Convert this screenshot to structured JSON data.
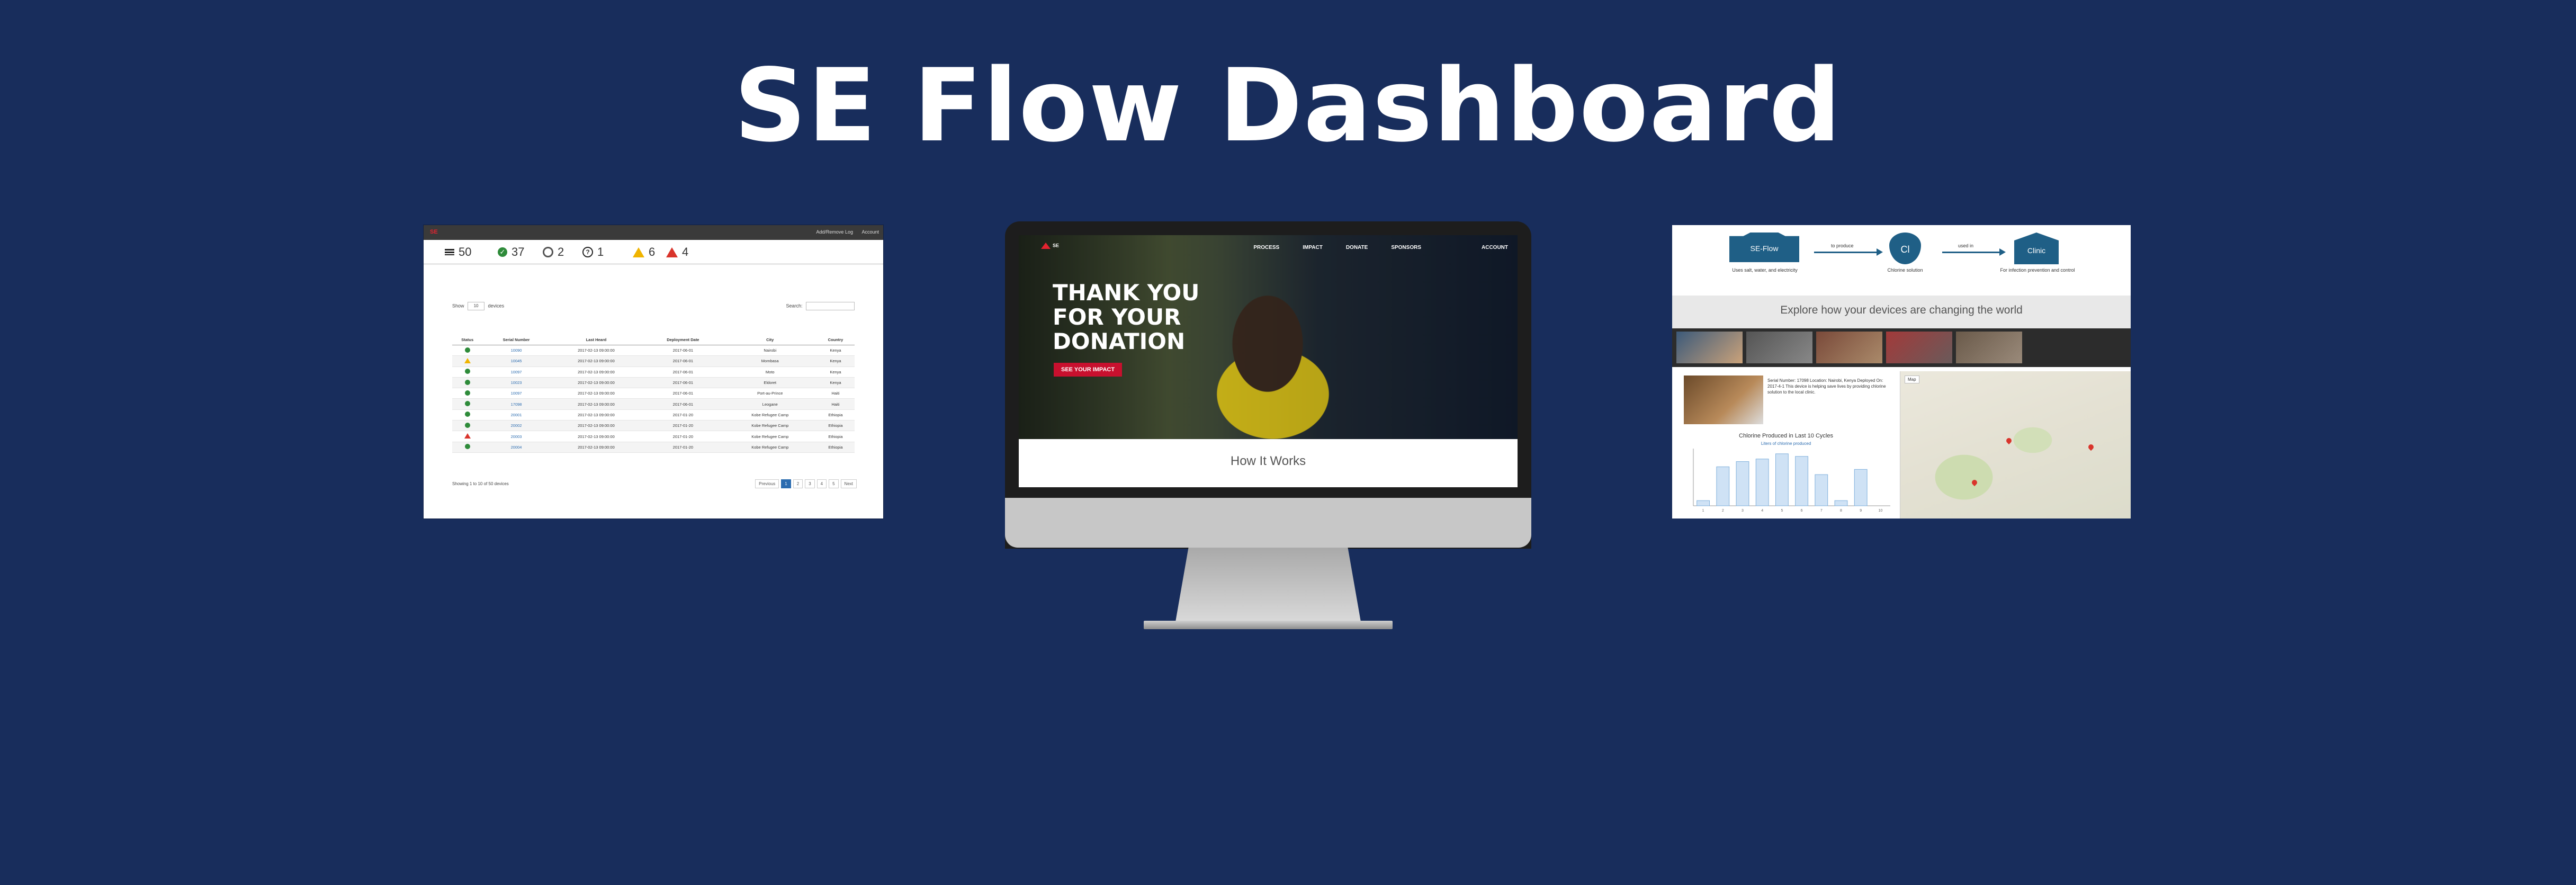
{
  "page": {
    "title": "SE Flow Dashboard",
    "background": "#182d5c"
  },
  "dashboard": {
    "logo": "SE",
    "nav": [
      "Add/Remove Log",
      "Account"
    ],
    "stats": [
      {
        "icon": "list-icon",
        "value": "50"
      },
      {
        "icon": "check-circle-icon",
        "value": "37"
      },
      {
        "icon": "ring-icon",
        "value": "2"
      },
      {
        "icon": "question-icon",
        "value": "1"
      },
      {
        "icon": "warning-icon",
        "value": "6"
      },
      {
        "icon": "error-icon",
        "value": "4"
      }
    ],
    "show_label": "Show",
    "show_value": "10",
    "entries_label": "devices",
    "search_label": "Search:",
    "columns": [
      "Status",
      "Serial Number",
      "Last Heard",
      "Deployment Date",
      "City",
      "Country"
    ],
    "rows": [
      {
        "status": "ok",
        "serial": "10090",
        "last": "2017-02-13 09:00:00",
        "deploy": "2017-06-01",
        "city": "Nairobi",
        "country": "Kenya"
      },
      {
        "status": "warn",
        "serial": "10045",
        "last": "2017-02-13 09:00:00",
        "deploy": "2017-06-01",
        "city": "Mombasa",
        "country": "Kenya"
      },
      {
        "status": "ok",
        "serial": "10097",
        "last": "2017-02-13 09:00:00",
        "deploy": "2017-06-01",
        "city": "Moto",
        "country": "Kenya"
      },
      {
        "status": "ok",
        "serial": "10023",
        "last": "2017-02-13 09:00:00",
        "deploy": "2017-06-01",
        "city": "Eldoret",
        "country": "Kenya"
      },
      {
        "status": "ok",
        "serial": "10097",
        "last": "2017-02-13 09:00:00",
        "deploy": "2017-06-01",
        "city": "Port-au-Prince",
        "country": "Haiti"
      },
      {
        "status": "ok",
        "serial": "17098",
        "last": "2017-02-13 09:00:00",
        "deploy": "2017-06-01",
        "city": "Leogane",
        "country": "Haiti"
      },
      {
        "status": "ok",
        "serial": "20001",
        "last": "2017-02-13 09:00:00",
        "deploy": "2017-01-20",
        "city": "Kobe Refugee Camp",
        "country": "Ethiopia"
      },
      {
        "status": "ok",
        "serial": "20002",
        "last": "2017-02-13 09:00:00",
        "deploy": "2017-01-20",
        "city": "Kobe Refugee Camp",
        "country": "Ethiopia"
      },
      {
        "status": "error",
        "serial": "20003",
        "last": "2017-02-13 09:00:00",
        "deploy": "2017-01-20",
        "city": "Kobe Refugee Camp",
        "country": "Ethiopia"
      },
      {
        "status": "ok",
        "serial": "20004",
        "last": "2017-02-13 09:00:00",
        "deploy": "2017-01-20",
        "city": "Kobe Refugee Camp",
        "country": "Ethiopia"
      }
    ],
    "entries_text": "Showing 1 to 10 of 50 devices",
    "pager": [
      "Previous",
      "1",
      "2",
      "3",
      "4",
      "5",
      "Next"
    ]
  },
  "donation_site": {
    "logo": "SE",
    "nav": [
      "PROCESS",
      "IMPACT",
      "DONATE",
      "SPONSORS",
      "ACCOUNT"
    ],
    "headline": "THANK YOU FOR YOUR DONATION",
    "cta": "SEE YOUR IMPACT",
    "section": "How It Works"
  },
  "impact_site": {
    "flow": {
      "step1": "SE-Flow",
      "step1_desc": "Uses salt, water, and electricity",
      "arrow1": "to produce",
      "step2": "Cl",
      "step2_desc": "Chlorine solution",
      "arrow2": "used in",
      "step3": "Clinic",
      "step3_desc": "For infection prevention and control"
    },
    "explore": "Explore how your devices are changing the world",
    "profile_text": "Serial Number: 17098 Location: Nairobi, Kenya Deployed On: 2017-4-1 This device is helping save lives by providing chlorine solution to the local clinic.",
    "chart_title": "Chlorine Produced in Last 10 Cycles",
    "chart_legend": "Liters of chlorine produced",
    "map_controls": "Map"
  },
  "chart_data": {
    "type": "bar",
    "title": "Chlorine Produced in Last 10 Cycles",
    "categories": [
      "1",
      "2",
      "3",
      "4",
      "5",
      "6",
      "7",
      "8",
      "9",
      "10"
    ],
    "series": [
      {
        "name": "Liters of chlorine produced",
        "values": [
          2,
          15,
          17,
          18,
          20,
          19,
          12,
          2,
          14,
          0
        ]
      }
    ],
    "ylim": [
      0,
      22
    ]
  }
}
